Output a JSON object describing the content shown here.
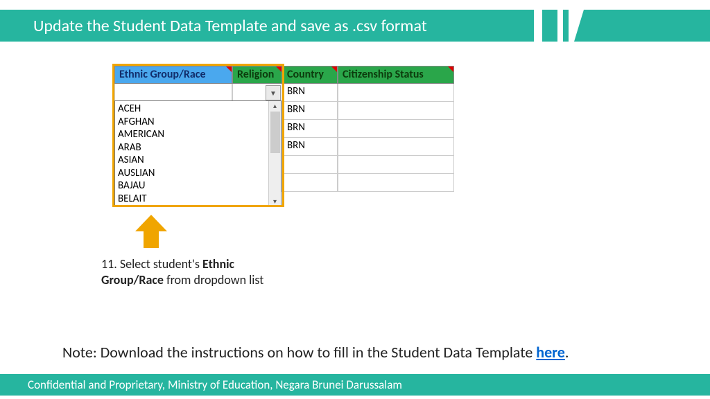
{
  "header": {
    "title": "Update the Student Data Template and save as .csv format"
  },
  "spreadsheet": {
    "columns": {
      "ethnic": "Ethnic Group/Race",
      "religion": "Religion",
      "country": "Country",
      "citizen": "Citizenship Status"
    },
    "country_values": [
      "BRN",
      "BRN",
      "BRN",
      "BRN"
    ],
    "dropdown_options": [
      "ACEH",
      "AFGHAN",
      "AMERICAN",
      "ARAB",
      "ASIAN",
      "AUSLIAN",
      "BAJAU",
      "BELAIT"
    ]
  },
  "instruction": {
    "number": "11.",
    "before_bold": "Select student's",
    "bold": "Ethnic Group/Race",
    "after_bold": "from dropdown list"
  },
  "note": {
    "prefix": "Note: Download the instructions on how to fill in the Student Data Template ",
    "link": "here",
    "suffix": "."
  },
  "footer": {
    "text": "Confidential and Proprietary, Ministry of Education, Negara Brunei Darussalam"
  }
}
